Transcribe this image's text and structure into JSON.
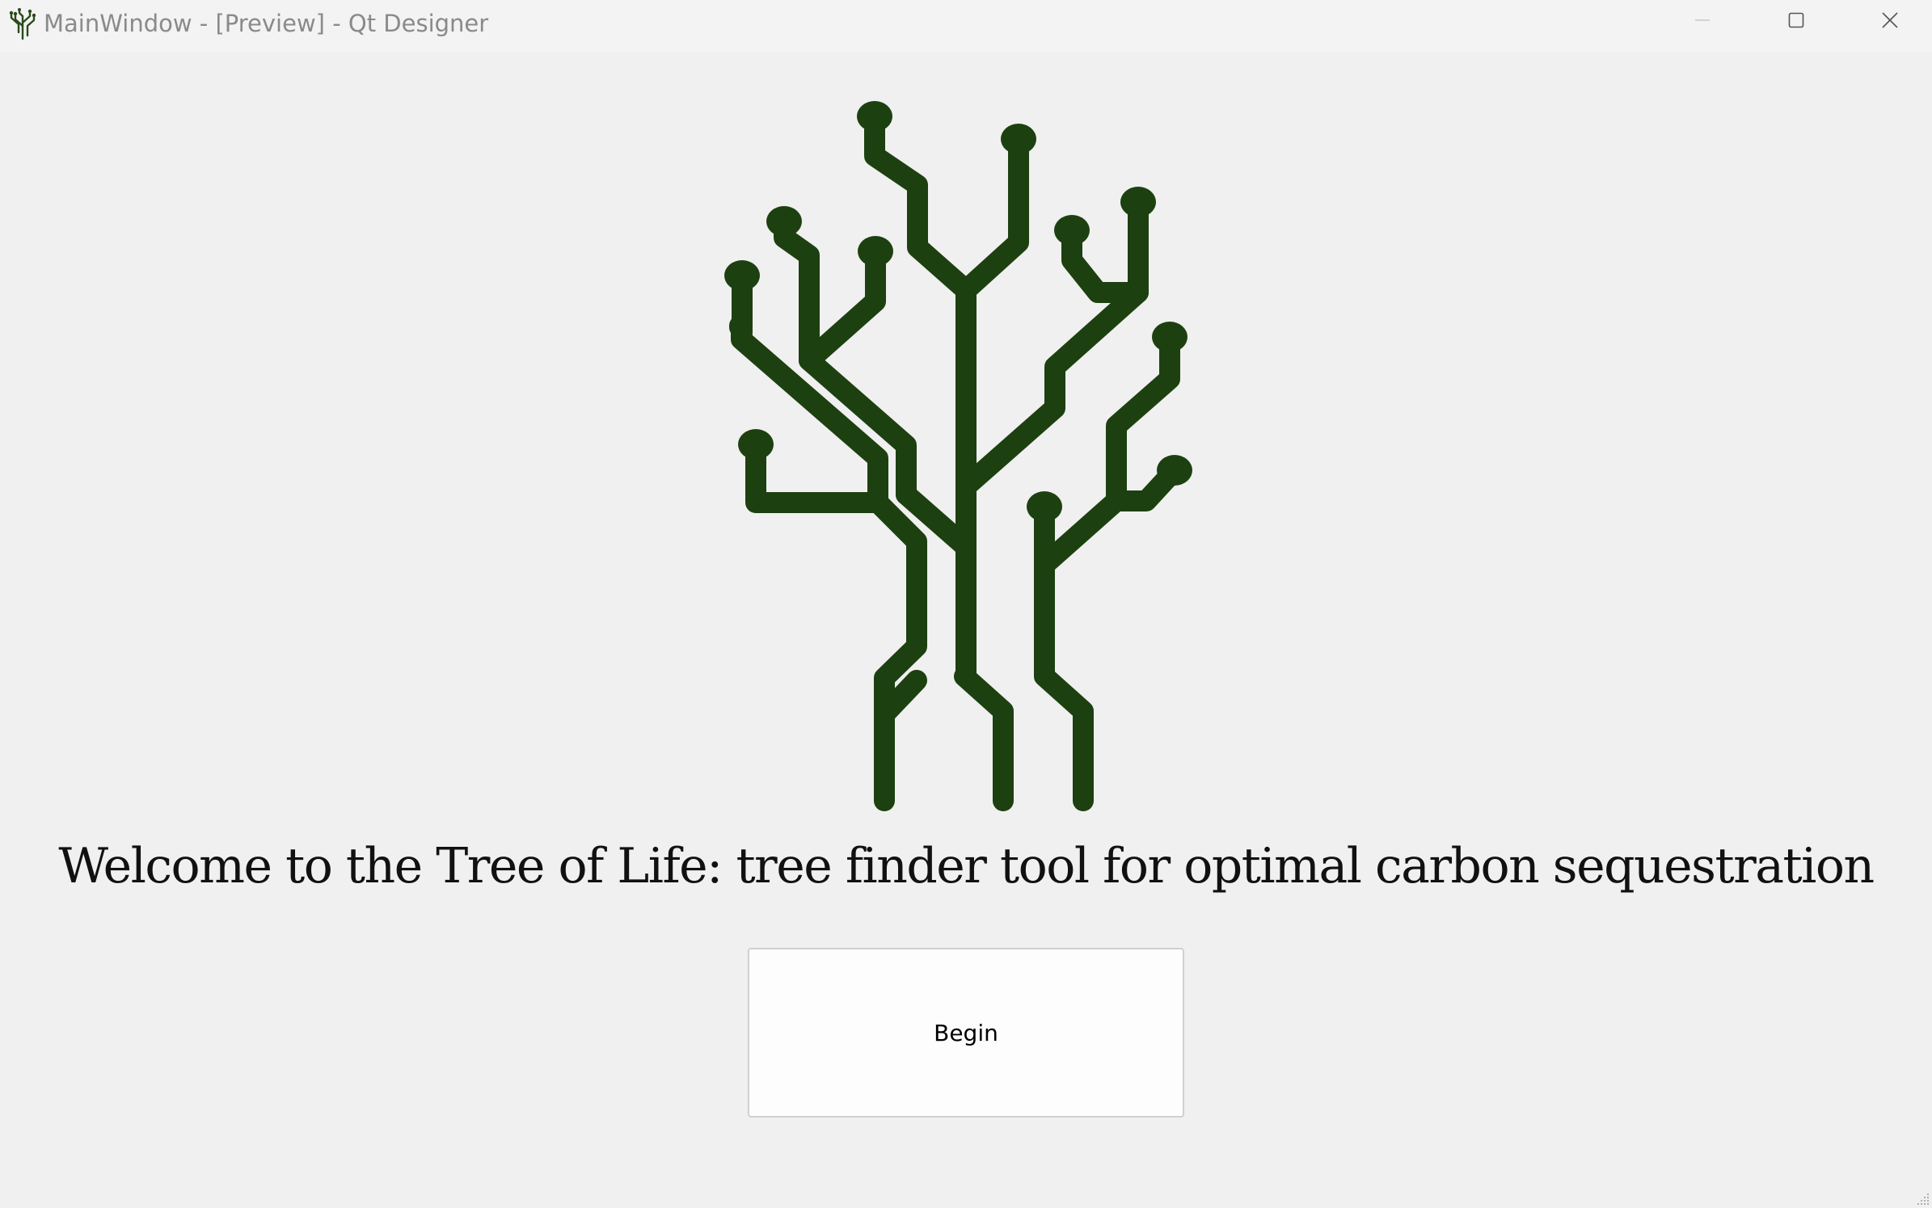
{
  "window": {
    "title": "MainWindow - [Preview] - Qt Designer",
    "icons": {
      "app": "tree-icon",
      "minimize": "minimize-icon",
      "maximize": "maximize-icon",
      "close": "close-icon"
    }
  },
  "main": {
    "logo_icon": "tree-of-life-logo",
    "welcome_text": "Welcome to the Tree of Life: tree finder tool for optimal carbon sequestration",
    "begin_button_label": "Begin"
  },
  "colors": {
    "logo_green": "#1d4010",
    "background": "#f0f0f0",
    "button_background": "#fdfdfd"
  }
}
